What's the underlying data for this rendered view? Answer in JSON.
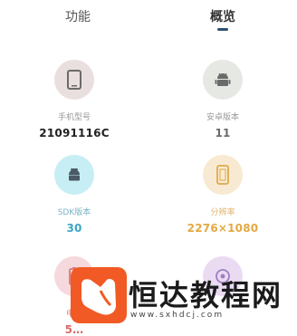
{
  "tabs": [
    {
      "label": "功能",
      "active": false
    },
    {
      "label": "概览",
      "active": true
    }
  ],
  "overview": {
    "items": [
      {
        "label": "手机型号",
        "value": "21091116C",
        "icon": "phone-icon",
        "circle": "#eadfdf",
        "icon_color": "#6b6b6b",
        "value_color": "#222222"
      },
      {
        "label": "安卓版本",
        "value": "11",
        "icon": "android-icon",
        "circle": "#e6e8e4",
        "icon_color": "#6a6a6a",
        "value_color": "#6b6b6b"
      },
      {
        "label": "SDK版本",
        "value": "30",
        "icon": "sdk-icon",
        "circle": "#c7eef4",
        "icon_color": "#4a5a66",
        "value_color": "#3aa6c4"
      },
      {
        "label": "分辨率",
        "value": "2276×1080",
        "icon": "screen-icon",
        "circle": "#f8ead2",
        "icon_color": "#e0a94b",
        "value_color": "#e2a943"
      },
      {
        "label": "电…",
        "value": "5…",
        "icon": "battery-icon",
        "circle": "#f6d9dc",
        "icon_color": "#d47a7a",
        "value_color": "#d86a6a"
      },
      {
        "label": "",
        "value": "",
        "icon": "storage-icon",
        "circle": "#eadbf3",
        "icon_color": "#a07fc1",
        "value_color": "#a07fc1"
      }
    ]
  },
  "watermark": {
    "title": "恒达教程网",
    "url": "www.sxhdcj.com",
    "logo_color": "#f15a24"
  }
}
